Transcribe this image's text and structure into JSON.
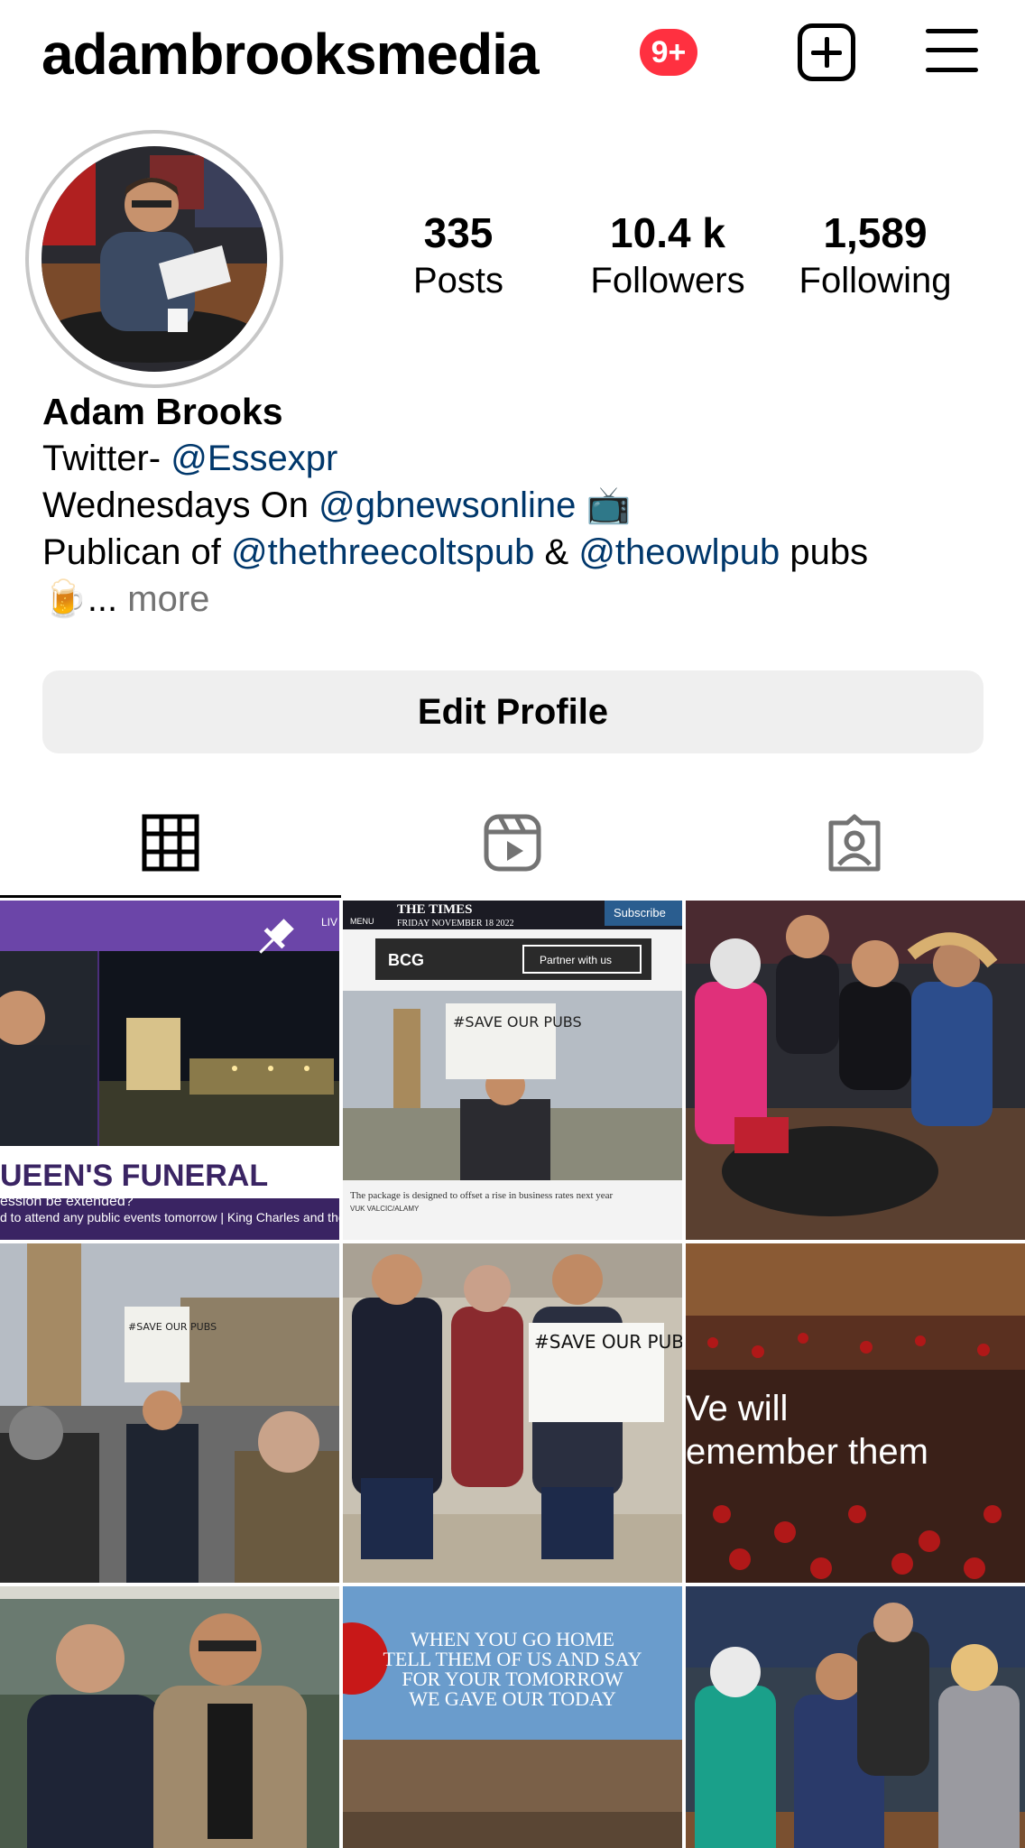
{
  "header": {
    "username": "adambrooksmedia",
    "notification_badge": "9+",
    "new_post_icon": "plus-square-icon",
    "menu_icon": "hamburger-menu-icon"
  },
  "profile": {
    "stats": {
      "posts_value": "335",
      "posts_label": "Posts",
      "followers_value": "10.4 k",
      "followers_label": "Followers",
      "following_value": "1,589",
      "following_label": "Following"
    },
    "display_name": "Adam Brooks",
    "bio": {
      "line1_prefix": "Twitter- ",
      "line1_mention": "@Essexpr",
      "line2_prefix": "Wednesdays On ",
      "line2_mention": "@gbnewsonline",
      "line2_emoji": "📺",
      "line3_prefix": "Publican of ",
      "line3_mention1": "@thethreecoltspub",
      "line3_mid": " & ",
      "line3_mention2": "@theowlpub",
      "line3_suffix": " pubs",
      "line4_emoji": "🍺",
      "line4_ellipsis": "... ",
      "more_label": "more"
    },
    "edit_profile_label": "Edit Profile"
  },
  "tabs": [
    {
      "icon": "grid-icon",
      "active": true
    },
    {
      "icon": "reels-icon",
      "active": false
    },
    {
      "icon": "tagged-icon",
      "active": false
    }
  ],
  "grid": {
    "tiles": [
      {
        "caption": "UEEN'S FUNERAL",
        "subcaption": "ession be extended?",
        "ticker": "d to attend any public events tomorrow | King Charles and the Ro",
        "pinned": true,
        "live_label": "LIV"
      },
      {
        "masthead": "THE TIMES",
        "date": "FRIDAY NOVEMBER 18 2022",
        "menu_label": "MENU",
        "subscribe_label": "Subscribe",
        "ad_brand": "BCG",
        "ad_label": "Partner with us",
        "sign_text": "#SAVE OUR PUBS",
        "article_caption": "The package is designed to offset a rise in business rates next year",
        "photo_credit": "VUK VALCIC/ALAMY"
      },
      {
        "description": "group-on-sofa"
      },
      {
        "sign_text": "#SAVE OUR PUBS"
      },
      {
        "sign_text": "#SAVE OUR PUBS"
      },
      {
        "overlay_line1": "Ve will",
        "overlay_line2": "emember them"
      },
      {
        "description": "stadium-photo"
      },
      {
        "poem_line1": "WHEN YOU GO HOME",
        "poem_line2": "TELL THEM OF US AND SAY",
        "poem_line3": "FOR YOUR TOMORROW",
        "poem_line4": "WE GAVE OUR TODAY"
      },
      {
        "description": "studio-group"
      }
    ]
  }
}
